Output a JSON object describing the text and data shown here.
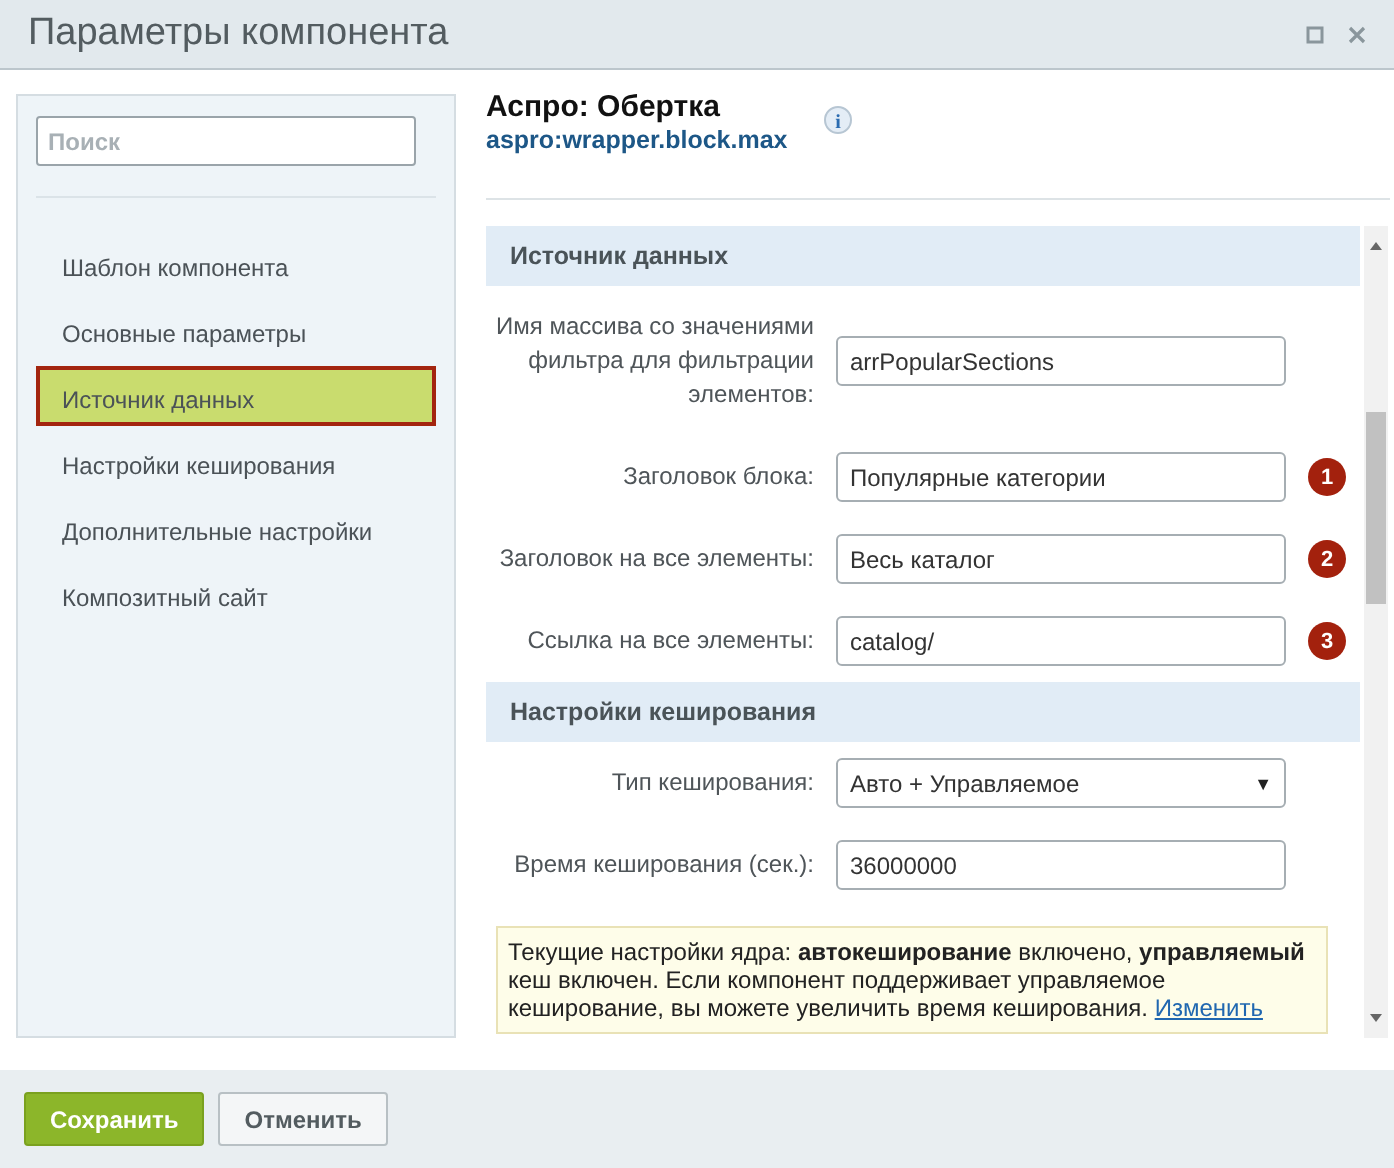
{
  "window": {
    "title": "Параметры компонента"
  },
  "sidebar": {
    "search": {
      "placeholder": "Поиск"
    },
    "items": [
      {
        "label": "Шаблон компонента",
        "selected": false
      },
      {
        "label": "Основные параметры",
        "selected": false
      },
      {
        "label": "Источник данных",
        "selected": true
      },
      {
        "label": "Настройки кеширования",
        "selected": false
      },
      {
        "label": "Дополнительные настройки",
        "selected": false
      },
      {
        "label": "Композитный сайт",
        "selected": false
      }
    ]
  },
  "component": {
    "name": "Аспро: Обертка",
    "code": "aspro:wrapper.block.max",
    "info_icon": "i"
  },
  "sections": [
    {
      "title": "Источник данных",
      "fields": [
        {
          "kind": "text",
          "label": "Имя массива со значениями фильтра для фильтрации элементов:",
          "value": "arrPopularSections"
        },
        {
          "kind": "text",
          "label": "Заголовок блока:",
          "value": "Популярные категории",
          "badge": "1"
        },
        {
          "kind": "text",
          "label": "Заголовок на все элементы:",
          "value": "Весь каталог",
          "badge": "2"
        },
        {
          "kind": "text",
          "label": "Ссылка на все элементы:",
          "value": "catalog/",
          "badge": "3"
        }
      ]
    },
    {
      "title": "Настройки кеширования",
      "fields": [
        {
          "kind": "select",
          "label": "Тип кеширования:",
          "value": "Авто + Управляемое",
          "caret": "▼"
        },
        {
          "kind": "text",
          "label": "Время кеширования (сек.):",
          "value": "36000000"
        }
      ],
      "notice": {
        "text": "Текущие настройки ядра: **автокеширование** включено, **управляемый** кеш включен. Если компонент поддерживает управляемое кеширование, вы можете увеличить время кеширования.",
        "link": "Изменить"
      }
    }
  ],
  "buttons": [
    {
      "label": "Сохранить",
      "kind": "primary"
    },
    {
      "label": "Отменить",
      "kind": "secondary"
    }
  ]
}
